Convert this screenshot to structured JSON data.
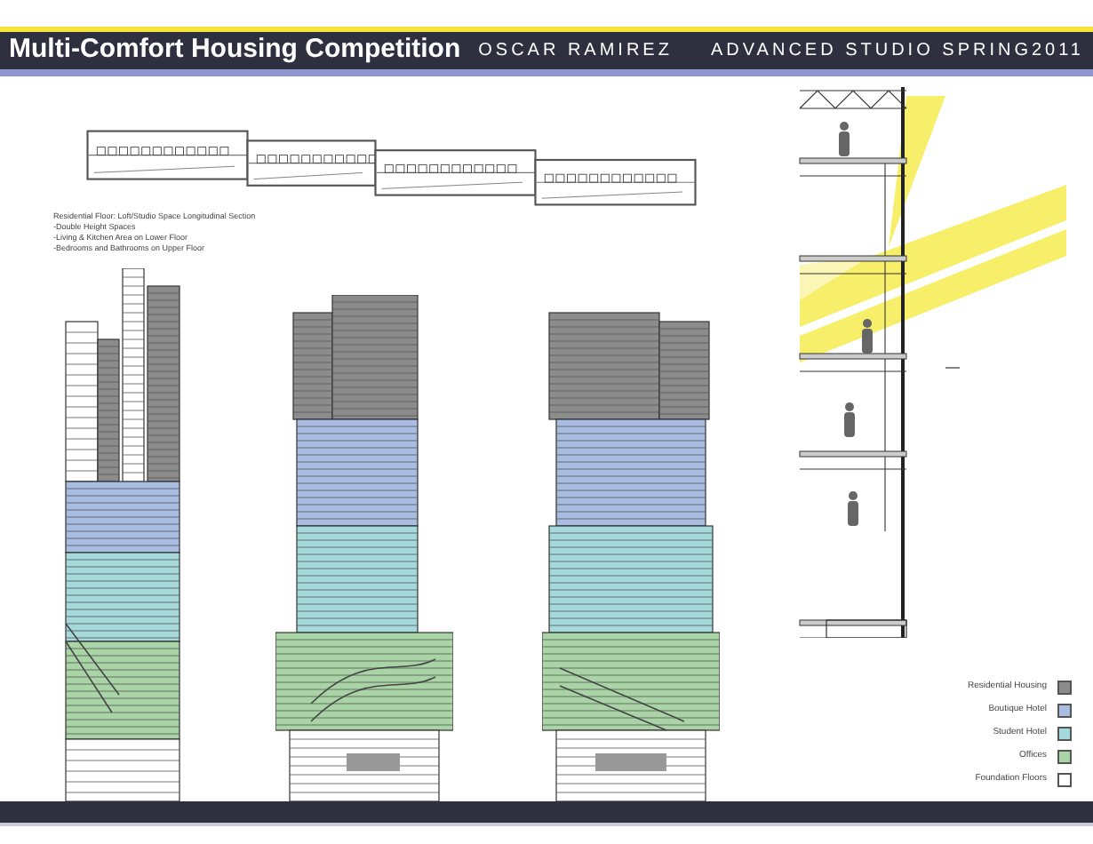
{
  "header": {
    "title": "Multi-Comfort Housing Competition",
    "author": "OSCAR RAMIREZ",
    "course": "ADVANCED STUDIO SPRING2011"
  },
  "section": {
    "notes": [
      "Residential Floor: Loft/Studio Space Longitudinal Section",
      "-Double Height Spaces",
      "-Living & Kitchen Area on Lower Floor",
      "-Bedrooms and Bathrooms on Upper Floor"
    ]
  },
  "legend": [
    {
      "label": "Residential Housing",
      "color": "#8c8c8c"
    },
    {
      "label": "Boutique Hotel",
      "color": "#a9bde3"
    },
    {
      "label": "Student Hotel",
      "color": "#a6d9dc"
    },
    {
      "label": "Offices",
      "color": "#a9d4a6"
    },
    {
      "label": "Foundation Floors",
      "color": "#ffffff"
    }
  ]
}
